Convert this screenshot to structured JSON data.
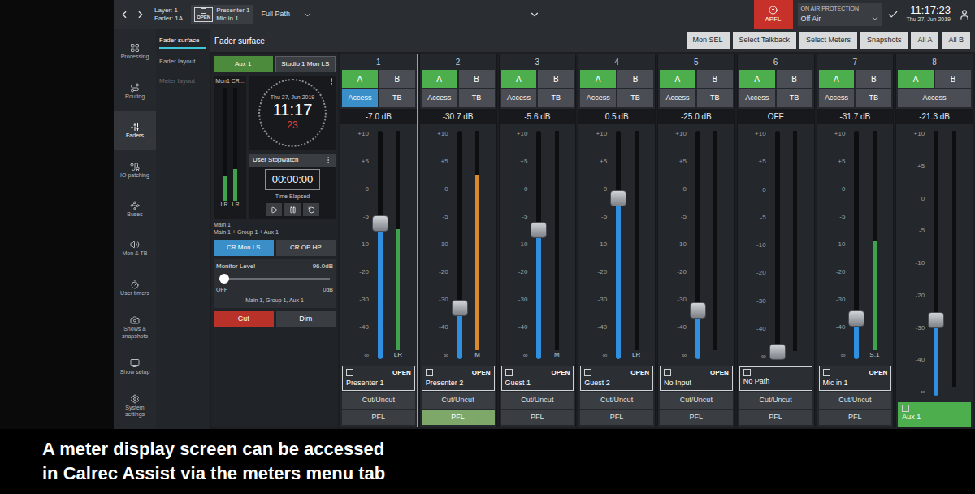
{
  "top_bar": {
    "layer": "Layer: 1",
    "fader": "Fader: 1A",
    "path_status": "OPEN",
    "path_source": "Presenter 1",
    "path_input": "Mic in 1",
    "view": "Full Path",
    "apfl": "APFL",
    "apfl_on": true,
    "on_air_label": "ON AIR PROTECTION",
    "on_air_value": "Off Air",
    "time": "11:17:23",
    "date": "Thu 27, Jun 2019"
  },
  "sidebar": {
    "items": [
      {
        "label": "Processing",
        "selected": false
      },
      {
        "label": "Routing",
        "selected": false
      },
      {
        "label": "Faders",
        "selected": true
      },
      {
        "label": "IO patching",
        "selected": false
      },
      {
        "label": "Buses",
        "selected": false
      },
      {
        "label": "Mon & TB",
        "selected": false
      },
      {
        "label": "User timers",
        "selected": false
      },
      {
        "label": "Shows & snapshots",
        "selected": false
      },
      {
        "label": "Show setup",
        "selected": false
      },
      {
        "label": "System settings",
        "selected": false
      }
    ]
  },
  "subnav": {
    "items": [
      {
        "label": "Fader surface",
        "selected": true,
        "disabled": false
      },
      {
        "label": "Fader layout",
        "selected": false,
        "disabled": false
      },
      {
        "label": "Meter layout",
        "selected": false,
        "disabled": true
      }
    ]
  },
  "page_title": "Fader surface",
  "toolbar": [
    "Mon SEL",
    "Select Talkback",
    "Select Meters",
    "Snapshots",
    "All A",
    "All B"
  ],
  "monitor": {
    "sources": [
      {
        "label": "Aux 1",
        "selected": true
      },
      {
        "label": "Studio 1 Mon LS",
        "selected": false
      }
    ],
    "meter_title": "Mon1 CR...",
    "meters": [
      {
        "label": "Main 1",
        "level": 0.22,
        "tag": "LR"
      },
      {
        "label": "Main 1 + Group 1 + Aux 1",
        "level": 0.28,
        "tag": "LR"
      }
    ],
    "clock": {
      "date": "Thu 27, Jun 2019",
      "time": "11:17",
      "seconds": "23"
    },
    "stopwatch": {
      "title": "User Stopwatch",
      "time": "00:00:00",
      "caption": "Time Elapsed"
    },
    "outputs": [
      {
        "label": "CR Mon LS",
        "selected": true
      },
      {
        "label": "CR OP HP",
        "selected": false
      }
    ],
    "level_title": "Monitor Level",
    "level_reading": "-96.0dB",
    "level": 0,
    "level_min": "OFF",
    "level_max": "0dB",
    "level_sources": "Main 1, Group 1, Aux 1",
    "cut": {
      "label": "Cut",
      "on": true
    },
    "dim": {
      "label": "Dim",
      "on": false
    }
  },
  "scale": [
    "+10",
    "+5",
    "0",
    "-5",
    "-10",
    "-20",
    "-30",
    "-40",
    "∞"
  ],
  "strips": [
    {
      "number": "1",
      "selected": true,
      "a": "A",
      "a_on": true,
      "b": "B",
      "b_on": false,
      "access": "Access",
      "access_selected": true,
      "tb": "TB",
      "reading": "-7.0 dB",
      "fader_level": 0.6,
      "meter_level": 0.55,
      "meter_color": "#3fa34d",
      "meter_label": "LR",
      "label": "Presenter 1",
      "label_highlight": false,
      "status": "OPEN",
      "cut": "Cut/Uncut",
      "pfl": "PFL",
      "pfl_on": false
    },
    {
      "number": "2",
      "selected": false,
      "a": "A",
      "a_on": true,
      "b": "B",
      "b_on": false,
      "access": "Access",
      "access_selected": false,
      "tb": "TB",
      "reading": "-30.7 dB",
      "fader_level": 0.2,
      "meter_level": 0.8,
      "meter_color": "#d98a2c",
      "meter_label": "M",
      "label": "Presenter 2",
      "label_highlight": false,
      "status": "OPEN",
      "cut": "Cut/Uncut",
      "pfl": "PFL",
      "pfl_on": true
    },
    {
      "number": "3",
      "selected": false,
      "a": "A",
      "a_on": true,
      "b": "B",
      "b_on": false,
      "access": "Access",
      "access_selected": false,
      "tb": "TB",
      "reading": "-5.6 dB",
      "fader_level": 0.57,
      "meter_level": 0,
      "meter_color": "#3fa34d",
      "meter_label": "M",
      "label": "Guest 1",
      "label_highlight": false,
      "status": "OPEN",
      "cut": "Cut/Uncut",
      "pfl": "PFL",
      "pfl_on": false
    },
    {
      "number": "4",
      "selected": false,
      "a": "A",
      "a_on": true,
      "b": "B",
      "b_on": false,
      "access": "Access",
      "access_selected": false,
      "tb": "TB",
      "reading": "0.5 dB",
      "fader_level": 0.72,
      "meter_level": 0,
      "meter_color": "#3fa34d",
      "meter_label": "LR",
      "label": "Guest 2",
      "label_highlight": false,
      "status": "OPEN",
      "cut": "Cut/Uncut",
      "pfl": "PFL",
      "pfl_on": false
    },
    {
      "number": "5",
      "selected": false,
      "a": "A",
      "a_on": true,
      "b": "B",
      "b_on": false,
      "access": "Access",
      "access_selected": false,
      "tb": "TB",
      "reading": "-25.0 dB",
      "fader_level": 0.19,
      "meter_level": 0,
      "meter_color": "#3fa34d",
      "meter_label": null,
      "label": "No Input",
      "label_highlight": false,
      "status": "OPEN",
      "cut": "Cut/Uncut",
      "pfl": "PFL",
      "pfl_on": false
    },
    {
      "number": "6",
      "selected": false,
      "a": "A",
      "a_on": true,
      "b": "B",
      "b_on": false,
      "access": "Access",
      "access_selected": false,
      "tb": "TB",
      "reading": "OFF",
      "fader_level": 0,
      "meter_level": 0,
      "meter_color": "#3fa34d",
      "meter_label": null,
      "label": "No Path",
      "label_highlight": false,
      "status": null,
      "cut": "Cut/Uncut",
      "pfl": "PFL",
      "pfl_on": false
    },
    {
      "number": "7",
      "selected": false,
      "a": "A",
      "a_on": true,
      "b": "B",
      "b_on": false,
      "access": "Access",
      "access_selected": false,
      "tb": "TB",
      "reading": "-31.7 dB",
      "fader_level": 0.15,
      "meter_level": 0.5,
      "meter_color": "#3fa34d",
      "meter_label": "S.1",
      "label": "Mic in 1",
      "label_highlight": false,
      "status": "OPEN",
      "cut": "Cut/Uncut",
      "pfl": "PFL",
      "pfl_on": false
    },
    {
      "number": "8",
      "selected": false,
      "a": "A",
      "a_on": true,
      "b": "B",
      "b_on": false,
      "access": "Access",
      "access_selected": false,
      "tb": null,
      "reading": "-21.3 dB",
      "fader_level": 0.27,
      "meter_level": 0,
      "meter_color": "#3fa34d",
      "meter_label": null,
      "label": "Aux 1",
      "label_highlight": true,
      "status": null,
      "cut": null,
      "pfl": null,
      "pfl_on": false
    }
  ],
  "caption": [
    "A meter display screen can be accessed",
    "in Calrec Assist via the meters menu tab"
  ]
}
